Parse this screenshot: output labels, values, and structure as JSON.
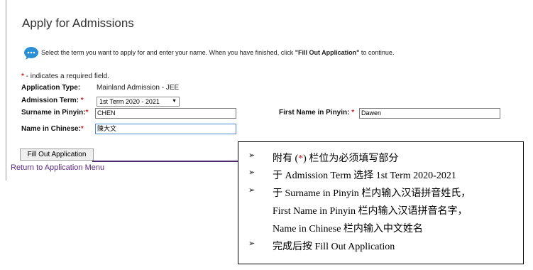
{
  "page": {
    "title": "Apply for Admissions",
    "instruction_prefix": "Select the term you want to apply for and enter your name. When you have finished, click ",
    "instruction_bold": "\"Fill Out Application\"",
    "instruction_suffix": " to continue.",
    "required_star": "*",
    "required_note": " - indicates a required field."
  },
  "form": {
    "application_type_label": "Application Type:",
    "application_type_value": "Mainland Admission - JEE",
    "admission_term_label": "Admission Term:",
    "admission_term_value": "1st Term 2020 - 2021",
    "surname_label": "Surname in Pinyin:",
    "surname_value": "CHEN",
    "first_name_label": "First Name in Pinyin:",
    "first_name_value": "Dawen",
    "chinese_name_label": "Name in Chinese:",
    "chinese_name_value": "陳大文"
  },
  "actions": {
    "fill_out_label": "Fill Out Application",
    "return_label": "Return to Application Menu"
  },
  "callout": {
    "bullet": "➢",
    "line1_a": "附有 (",
    "line1_star": "*",
    "line1_b": ") 栏位为必须填写部分",
    "line2": "于 Admission Term 选择 1st Term 2020-2021",
    "line3": "于 Surname in Pinyin 栏内输入汉语拼音姓氏，",
    "line4": "First Name in Pinyin 栏内输入汉语拼音名字，",
    "line5": "Name in Chinese 栏内输入中文姓名",
    "line6": "完成后按 Fill Out Application"
  },
  "colors": {
    "required_star": "#d42020",
    "link": "#5a2a82",
    "icon_blue": "#2b8fd6"
  }
}
